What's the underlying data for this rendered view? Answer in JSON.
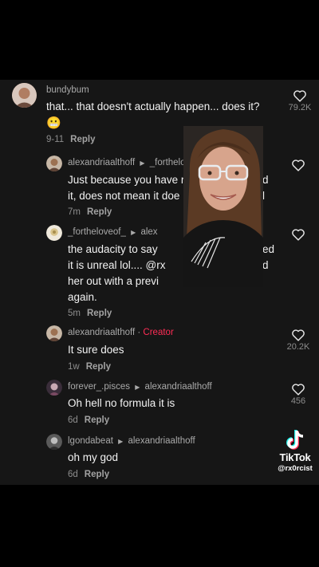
{
  "comments": [
    {
      "username": "bundybum",
      "text": "that... that doesn't actually happen... does it?",
      "emoji": "😬",
      "time": "9-11",
      "reply": "Reply",
      "likes": "79.2K"
    },
    {
      "username": "alexandriaalthoff",
      "reply_to": "_fortheloveof_",
      "reply_to_visible": "_forthelo",
      "text_line1": "Just because you have r",
      "text_line1_end": "d",
      "text_line2": "it, does not mean it doe",
      "text_line2_end": "l",
      "time": "7m",
      "reply": "Reply"
    },
    {
      "username": "_fortheloveof_",
      "reply_to_visible": "alex",
      "text_line1": "the audacity to say",
      "text_line1_end": "ed",
      "text_line2": "it is unreal lol.... @rx",
      "text_line2_end": "d",
      "text_line3": "her out with a previ",
      "text_line4": "again.",
      "time": "5m",
      "reply": "Reply"
    },
    {
      "username": "alexandriaalthoff",
      "badge": "Creator",
      "text": "It sure does",
      "time": "1w",
      "reply": "Reply",
      "likes": "20.2K"
    },
    {
      "username": "forever_.pisces",
      "reply_to": "alexandriaalthoff",
      "text": "Oh hell no formula it is",
      "time": "6d",
      "reply": "Reply",
      "likes": "456"
    },
    {
      "username": "lgondabeat",
      "reply_to": "alexandriaalthoff",
      "text": "oh my god",
      "time": "6d",
      "reply": "Reply"
    }
  ],
  "watermark": {
    "brand": "TikTok",
    "handle": "@rx0rcist"
  },
  "icons": {
    "like": "heart-outline-icon",
    "reply_arrow": "caret-right-icon",
    "tiktok": "tiktok-logo-icon"
  },
  "colors": {
    "background": "#161616",
    "creator_badge": "#fe2c55",
    "muted": "#8d8d8d"
  }
}
